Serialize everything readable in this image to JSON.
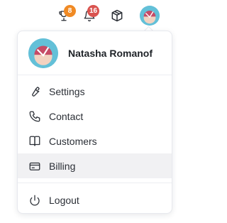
{
  "header": {
    "trophy_badge": "8",
    "bell_badge": "16",
    "trophy_badge_color": "#f08a24",
    "bell_badge_color": "#d9534f"
  },
  "profile": {
    "name": "Natasha Romanof"
  },
  "menu": {
    "items": [
      {
        "label": "Settings",
        "icon": "wrench-icon"
      },
      {
        "label": "Contact",
        "icon": "phone-icon"
      },
      {
        "label": "Customers",
        "icon": "book-icon"
      },
      {
        "label": "Billing",
        "icon": "credit-card-icon",
        "active": true
      }
    ],
    "logout_label": "Logout"
  }
}
